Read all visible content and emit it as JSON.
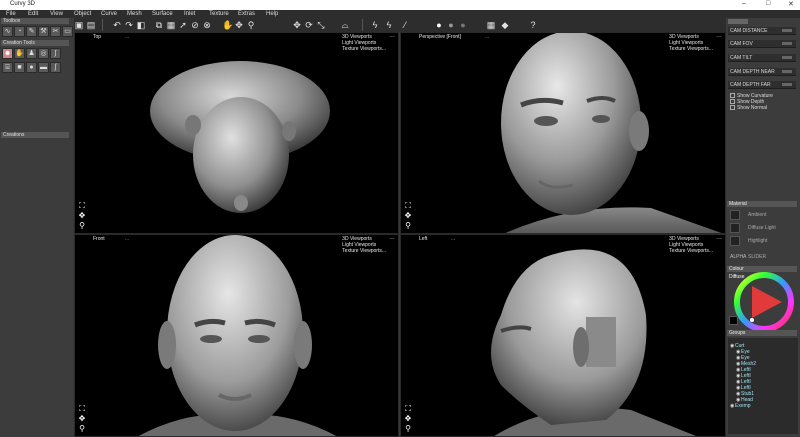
{
  "window": {
    "title": "Curvy 3D",
    "controls": [
      "–",
      "□",
      "✕"
    ]
  },
  "menu": [
    "File",
    "Edit",
    "View",
    "Object",
    "Curve",
    "Mesh",
    "Surface",
    "Inlet",
    "Texture",
    "Extras",
    "Help"
  ],
  "left_panel": {
    "toolbox": "Toolbox",
    "creation_tools": "Creation Tools",
    "creations": "Creations"
  },
  "viewports": [
    {
      "title": "Top",
      "dots": "...",
      "menu": [
        "3D Viewports",
        "Light Viewports",
        "Texture Viewports..."
      ]
    },
    {
      "title": "Perspective [Front]",
      "dots": "...",
      "menu": [
        "3D Viewports",
        "Light Viewports",
        "Texture Viewports..."
      ]
    },
    {
      "title": "Front",
      "dots": "...",
      "menu": [
        "3D Viewports",
        "Light Viewports",
        "Texture Viewports..."
      ]
    },
    {
      "title": "Left",
      "dots": "...",
      "menu": [
        "3D Viewports",
        "Light Viewports",
        "Texture Viewports..."
      ]
    }
  ],
  "right_panel": {
    "camera": [
      "CAM DISTANCE",
      "CAM FOV",
      "CAM TILT",
      "CAM DEPTH NEAR",
      "CAM DEPTH FAR"
    ],
    "checkboxes": [
      "Show Curvature",
      "Show Depth",
      "Show Normal"
    ],
    "material_header": "Material",
    "material": [
      "Ambient",
      "Diffuse Light",
      "Highlight"
    ],
    "alpha": "ALPHA",
    "alpha_value": "SLIDER",
    "colour_header": "Colour",
    "colour_mode": "Diffuse",
    "groups_header": "Groups",
    "groups": [
      "Curt",
      "Eye",
      "Eye",
      "Mesh2",
      "LeftI",
      "LeftI",
      "LeftI",
      "LeftI",
      "Stub1",
      "Head",
      "Exemp"
    ]
  },
  "colors": {
    "accent_red": "#e03a3a",
    "viewport_bg": "#000000",
    "panel_bg": "#3c3c3c"
  }
}
